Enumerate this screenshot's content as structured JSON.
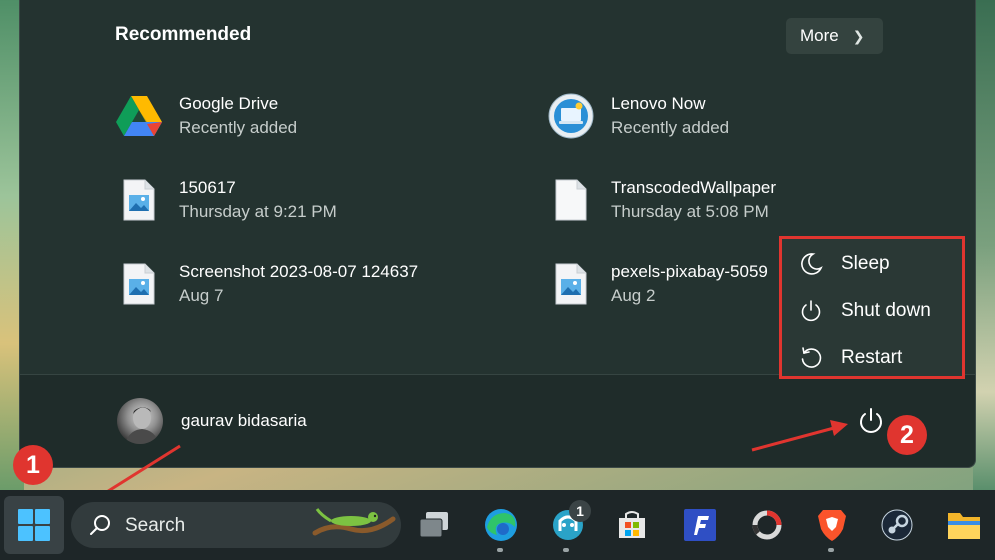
{
  "start_menu": {
    "recommended_title": "Recommended",
    "more_label": "More",
    "items": [
      {
        "name": "Google Drive",
        "sub": "Recently added",
        "icon": "google-drive-icon"
      },
      {
        "name": "Lenovo Now",
        "sub": "Recently added",
        "icon": "lenovo-now-icon"
      },
      {
        "name": "150617",
        "sub": "Thursday at 9:21 PM",
        "icon": "image-file-icon"
      },
      {
        "name": "TranscodedWallpaper",
        "sub": "Thursday at 5:08 PM",
        "icon": "blank-file-icon"
      },
      {
        "name": "Screenshot 2023-08-07 124637",
        "sub": "Aug 7",
        "icon": "image-file-icon"
      },
      {
        "name": "pexels-pixabay-5059",
        "sub": "Aug 2",
        "icon": "image-file-icon"
      }
    ],
    "user_name": "gaurav bidasaria"
  },
  "power_menu": {
    "sleep": "Sleep",
    "shutdown": "Shut down",
    "restart": "Restart"
  },
  "annotations": {
    "badge1": "1",
    "badge2": "2",
    "color": "#e0352f"
  },
  "taskbar": {
    "search_label": "Search",
    "notification_count": "1",
    "icons": [
      "windows-start-icon",
      "task-view-icon",
      "edge-icon",
      "copilot-icon",
      "store-icon",
      "app-f-icon",
      "app-ring-icon",
      "brave-icon",
      "steam-icon",
      "file-explorer-icon"
    ]
  }
}
